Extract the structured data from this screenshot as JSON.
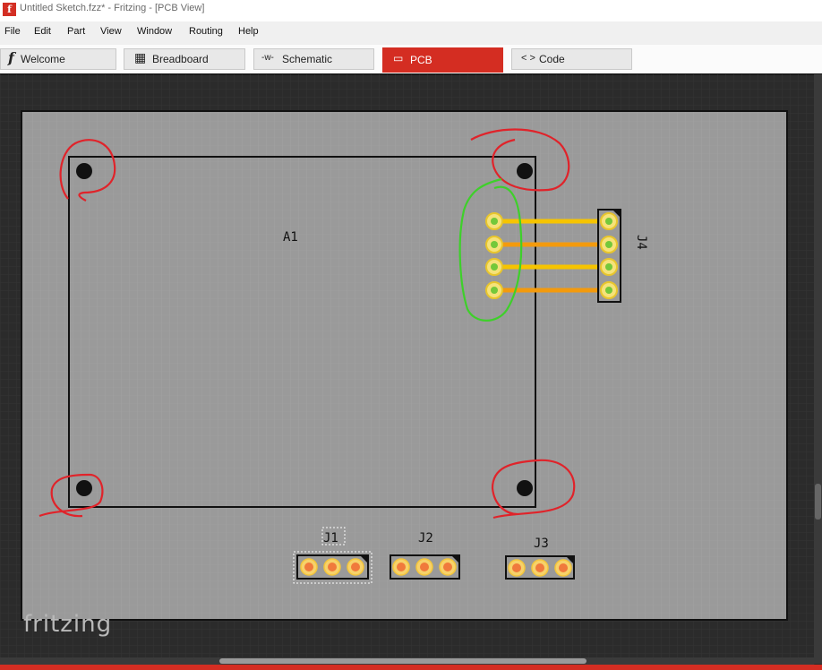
{
  "window": {
    "title": "Untitled Sketch.fzz* - Fritzing - [PCB View]",
    "app_icon": "f"
  },
  "menu": [
    "File",
    "Edit",
    "Part",
    "View",
    "Window",
    "Routing",
    "Help"
  ],
  "tabs": [
    {
      "label": "Welcome",
      "icon": "f",
      "icon_name": "fritzing-f-icon"
    },
    {
      "label": "Breadboard",
      "icon": "▦",
      "icon_name": "breadboard-icon"
    },
    {
      "label": "Schematic",
      "icon": "-w-",
      "icon_name": "resistor-icon"
    },
    {
      "label": "PCB",
      "icon": "▭",
      "icon_name": "pcb-icon",
      "active": true
    },
    {
      "label": "Code",
      "icon": "< >",
      "icon_name": "code-brackets-icon"
    }
  ],
  "pcb": {
    "parts": {
      "a1": "A1",
      "j1": "J1",
      "j2": "J2",
      "j3": "J3",
      "j4": "J4"
    },
    "watermark": "fritzing"
  },
  "colors": {
    "active_tab": "#d42d22",
    "board": "#9a9a9a",
    "trace_top": "#f6c400",
    "trace_bottom": "#f39a0d",
    "pad_green": "#74c83a",
    "pad_orange": "#f07a3c",
    "annotation_red": "#e0232a",
    "annotation_green": "#3ed02a"
  }
}
